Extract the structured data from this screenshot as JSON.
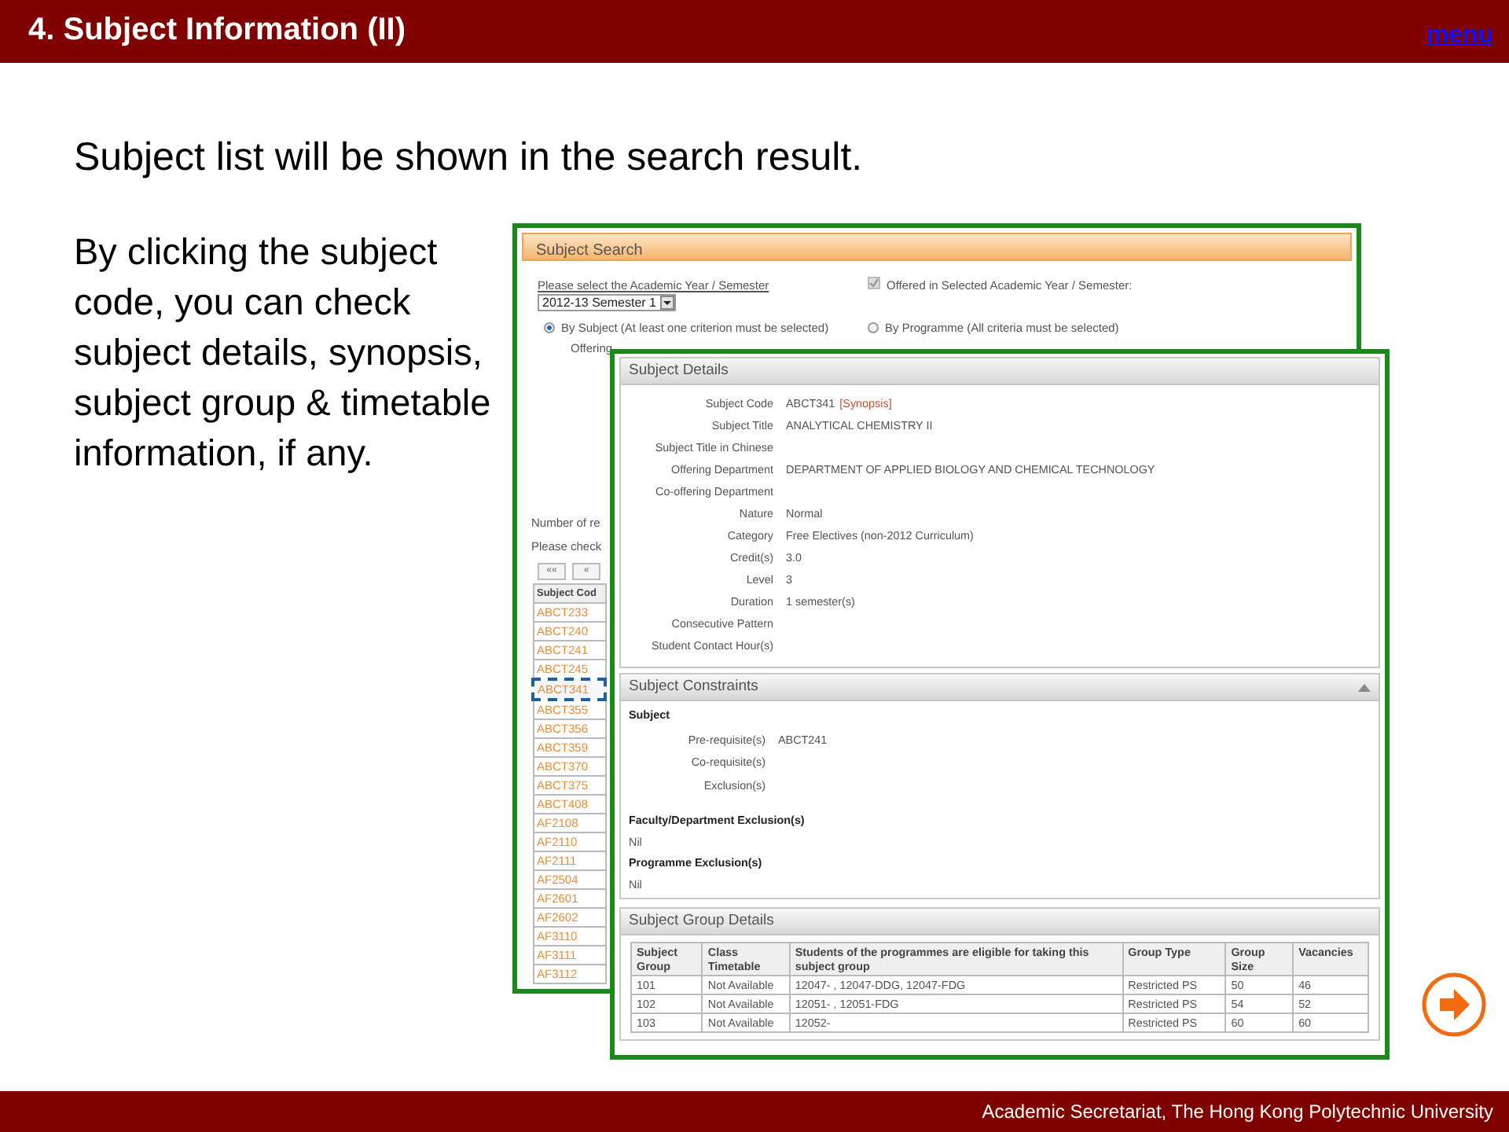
{
  "header": {
    "title": "4. Subject Information (II)",
    "menu_link": "menu"
  },
  "heading": "Subject list will be shown in the search result.",
  "description": "By clicking the subject code, you can check subject details, synopsis, subject group & timetable information, if any.",
  "search_screen": {
    "title": "Subject Search",
    "year_label": "Please select the Academic Year / Semester",
    "year_value": "2012-13 Semester 1",
    "offered": {
      "label": "Offered in Selected Academic Year / Semester:",
      "checked": true,
      "disabled": true
    },
    "search_modes": [
      {
        "label": "By Subject (At least one criterion must be selected)",
        "selected": true
      },
      {
        "label": "By Programme (All criteria must be selected)",
        "selected": false
      }
    ],
    "department_label": "Offering",
    "results_label": "Number of re",
    "check_label": "Please check",
    "pager": [
      "««",
      "«"
    ],
    "column": "Subject Cod",
    "codes": [
      {
        "code": "ABCT233",
        "highlighted": false
      },
      {
        "code": "ABCT240",
        "highlighted": false
      },
      {
        "code": "ABCT241",
        "highlighted": false
      },
      {
        "code": "ABCT245",
        "highlighted": false
      },
      {
        "code": "ABCT341",
        "highlighted": true
      },
      {
        "code": "ABCT355",
        "highlighted": false
      },
      {
        "code": "ABCT356",
        "highlighted": false
      },
      {
        "code": "ABCT359",
        "highlighted": false
      },
      {
        "code": "ABCT370",
        "highlighted": false
      },
      {
        "code": "ABCT375",
        "highlighted": false
      },
      {
        "code": "ABCT408",
        "highlighted": false
      },
      {
        "code": "AF2108",
        "highlighted": false
      },
      {
        "code": "AF2110",
        "highlighted": false
      },
      {
        "code": "AF2111",
        "highlighted": false
      },
      {
        "code": "AF2504",
        "highlighted": false
      },
      {
        "code": "AF2601",
        "highlighted": false
      },
      {
        "code": "AF2602",
        "highlighted": false
      },
      {
        "code": "AF3110",
        "highlighted": false
      },
      {
        "code": "AF3111",
        "highlighted": false
      },
      {
        "code": "AF3112",
        "highlighted": false
      }
    ]
  },
  "details_screen": {
    "details": {
      "title": "Subject Details",
      "fields": [
        {
          "label": "Subject Code",
          "value": "ABCT341",
          "link": "[Synopsis]"
        },
        {
          "label": "Subject Title",
          "value": "ANALYTICAL CHEMISTRY II"
        },
        {
          "label": "Subject Title in Chinese"
        },
        {
          "label": "Offering Department",
          "value": "DEPARTMENT OF APPLIED BIOLOGY AND CHEMICAL TECHNOLOGY"
        },
        {
          "label": "Co-offering Department"
        },
        {
          "label": "Nature",
          "value": "Normal"
        },
        {
          "label": "Category",
          "value": "Free Electives (non-2012 Curriculum)"
        },
        {
          "label": "Credit(s)",
          "value": "3.0"
        },
        {
          "label": "Level",
          "value": "3"
        },
        {
          "label": "Duration",
          "value": "1 semester(s)"
        },
        {
          "label": "Consecutive Pattern"
        },
        {
          "label": "Student Contact Hour(s)"
        }
      ]
    },
    "constraints": {
      "title": "Subject Constraints",
      "expanded": true,
      "subject_heading": "Subject",
      "fields": [
        {
          "label": "Pre-requisite(s)",
          "value": "ABCT241"
        },
        {
          "label": "Co-requisite(s)"
        },
        {
          "label": "Exclusion(s)"
        }
      ],
      "sections": [
        {
          "heading": "Faculty/Department Exclusion(s)",
          "value": "Nil"
        },
        {
          "heading": "Programme Exclusion(s)",
          "value": "Nil"
        }
      ]
    },
    "groups": {
      "title": "Subject Group Details",
      "columns": [
        "Subject Group",
        "Class Timetable",
        "Students of the programmes are eligible for taking this subject group",
        "Group Type",
        "Group Size",
        "Vacancies"
      ],
      "rows": [
        [
          "101",
          "Not Available",
          "12047- , 12047-DDG, 12047-FDG",
          "Restricted PS",
          "50",
          "46"
        ],
        [
          "102",
          "Not Available",
          "12051- , 12051-FDG",
          "Restricted PS",
          "54",
          "52"
        ],
        [
          "103",
          "Not Available",
          "12052-",
          "Restricted PS",
          "60",
          "60"
        ]
      ]
    }
  },
  "footer": "Academic Secretariat, The Hong Kong Polytechnic University"
}
